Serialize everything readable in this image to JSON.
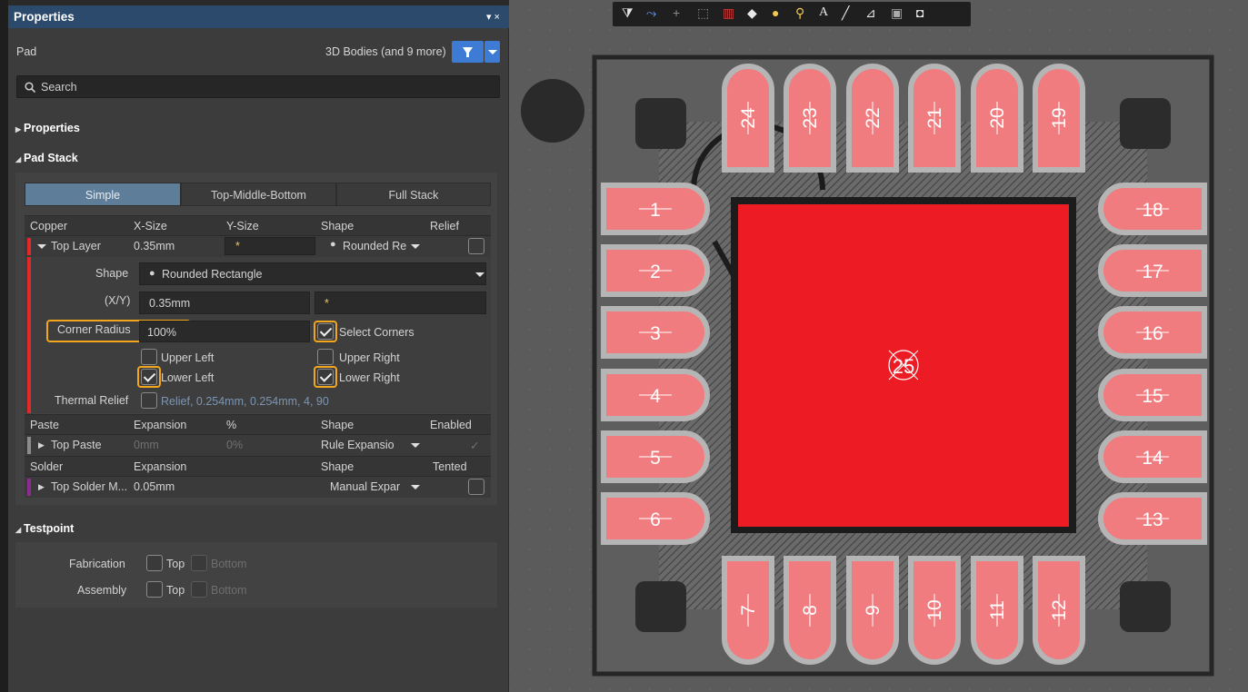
{
  "panel": {
    "title": "Properties",
    "title_controls": "▾ ×",
    "object_kind": "Pad",
    "filter_label": "3D Bodies (and 9 more)",
    "search_placeholder": "Search",
    "sections": {
      "properties": "Properties",
      "pad_stack": "Pad Stack",
      "testpoint": "Testpoint"
    }
  },
  "pad_stack": {
    "modes": [
      "Simple",
      "Top-Middle-Bottom",
      "Full Stack"
    ],
    "active_mode": "Simple",
    "copper_headers": [
      "Copper",
      "X-Size",
      "Y-Size",
      "Shape",
      "Relief"
    ],
    "top_layer": {
      "name": "Top Layer",
      "x_size": "0.35mm",
      "y_size": "*",
      "shape": "Rounded Re",
      "relief_checked": false
    },
    "shape_label": "Shape",
    "shape_value": "Rounded Rectangle",
    "xy_label": "(X/Y)",
    "xy_x": "0.35mm",
    "xy_y": "*",
    "corner_radius_label": "Corner Radius",
    "corner_radius_value": "100%",
    "select_corners_label": "Select Corners",
    "select_corners_checked": true,
    "corners": {
      "upper_left": {
        "label": "Upper Left",
        "checked": false
      },
      "upper_right": {
        "label": "Upper Right",
        "checked": false
      },
      "lower_left": {
        "label": "Lower Left",
        "checked": true
      },
      "lower_right": {
        "label": "Lower Right",
        "checked": true
      }
    },
    "thermal_relief_label": "Thermal Relief",
    "thermal_relief_value": "Relief, 0.254mm, 0.254mm, 4, 90",
    "paste_headers": [
      "Paste",
      "Expansion",
      "%",
      "Shape",
      "Enabled"
    ],
    "top_paste": {
      "name": "Top Paste",
      "expansion": "0mm",
      "percent": "0%",
      "shape": "Rule Expansio"
    },
    "solder_headers": [
      "Solder",
      "Expansion",
      "",
      "Shape",
      "Tented"
    ],
    "top_solder": {
      "name": "Top Solder M...",
      "expansion": "0.05mm",
      "shape": "Manual Expar"
    }
  },
  "testpoint": {
    "fabrication_label": "Fabrication",
    "assembly_label": "Assembly",
    "top_label": "Top",
    "bottom_label": "Bottom"
  },
  "pcb": {
    "pads_top": [
      "24",
      "23",
      "22",
      "21",
      "20",
      "19"
    ],
    "pads_left": [
      "1",
      "2",
      "3",
      "4",
      "5",
      "6"
    ],
    "pads_right": [
      "18",
      "17",
      "16",
      "15",
      "14",
      "13"
    ],
    "pads_bottom": [
      "7",
      "8",
      "9",
      "10",
      "11",
      "12"
    ],
    "center_pad": "25",
    "colors": {
      "pad": "#f07c7f",
      "center_pad": "#ed1c24",
      "pad_outline": "#b5b5b5",
      "board_edge": "#262626",
      "accent": "#f2a61c"
    }
  },
  "toolbar": {
    "icons": [
      "filter-icon",
      "route-icon",
      "cross-icon",
      "select-rect-icon",
      "bar-chart-icon",
      "eraser-icon",
      "pad-icon",
      "via-icon",
      "text-icon",
      "line-icon",
      "dimension-icon",
      "component-icon",
      "region-icon"
    ]
  }
}
